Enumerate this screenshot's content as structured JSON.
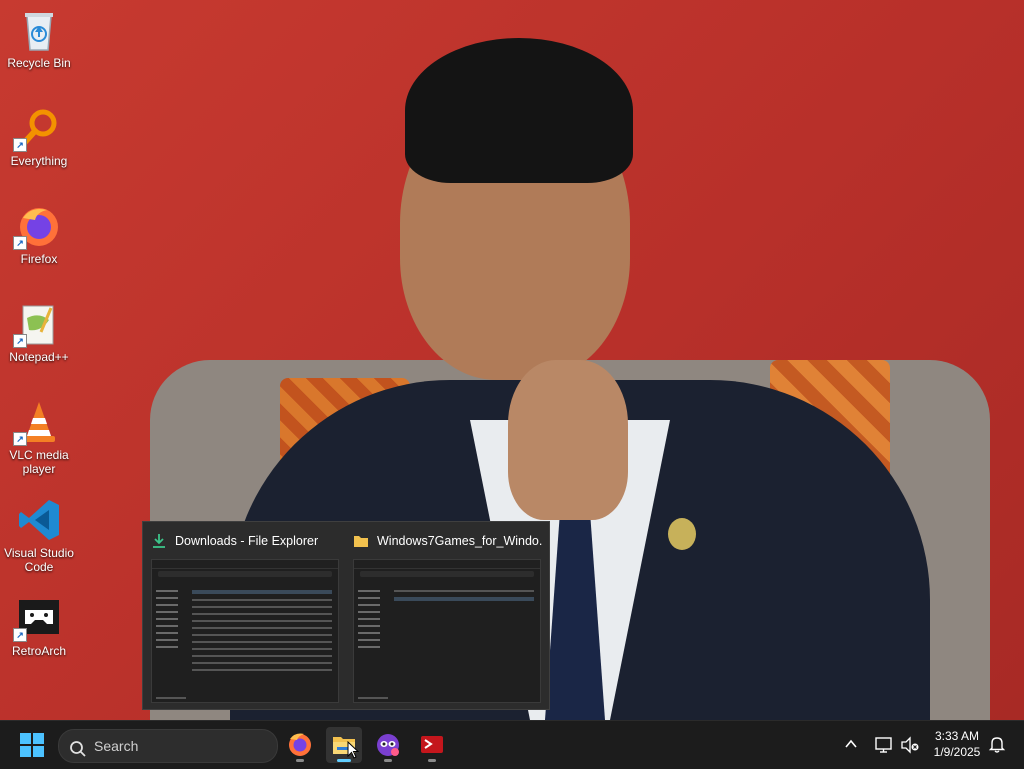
{
  "desktop": {
    "icons": [
      {
        "label": "Recycle Bin",
        "icon": "recycle-bin-icon"
      },
      {
        "label": "Everything",
        "icon": "everything-search-icon"
      },
      {
        "label": "Firefox",
        "icon": "firefox-icon"
      },
      {
        "label": "Notepad++",
        "icon": "notepad-plus-plus-icon"
      },
      {
        "label": "VLC media player",
        "icon": "vlc-icon"
      },
      {
        "label": "Visual Studio Code",
        "icon": "vscode-icon"
      },
      {
        "label": "RetroArch",
        "icon": "retroarch-icon"
      }
    ]
  },
  "thumbnails": [
    {
      "title": "Downloads - File Explorer",
      "icon": "download-arrow-icon"
    },
    {
      "title": "Windows7Games_for_Windo...",
      "icon": "folder-icon"
    }
  ],
  "taskbar": {
    "search_label": "Search",
    "apps": [
      {
        "name": "Firefox",
        "icon": "firefox-icon"
      },
      {
        "name": "File Explorer",
        "icon": "file-explorer-icon"
      },
      {
        "name": "Tor / Privacy app",
        "icon": "masked-app-icon"
      },
      {
        "name": "Terminal",
        "icon": "red-terminal-icon"
      }
    ]
  },
  "tray": {
    "time": "3:33 AM",
    "date": "1/9/2025"
  },
  "colors": {
    "taskbar_bg": "#1c1c1c",
    "active_indicator": "#60cdff",
    "wallpaper_red": "#c2342c"
  }
}
